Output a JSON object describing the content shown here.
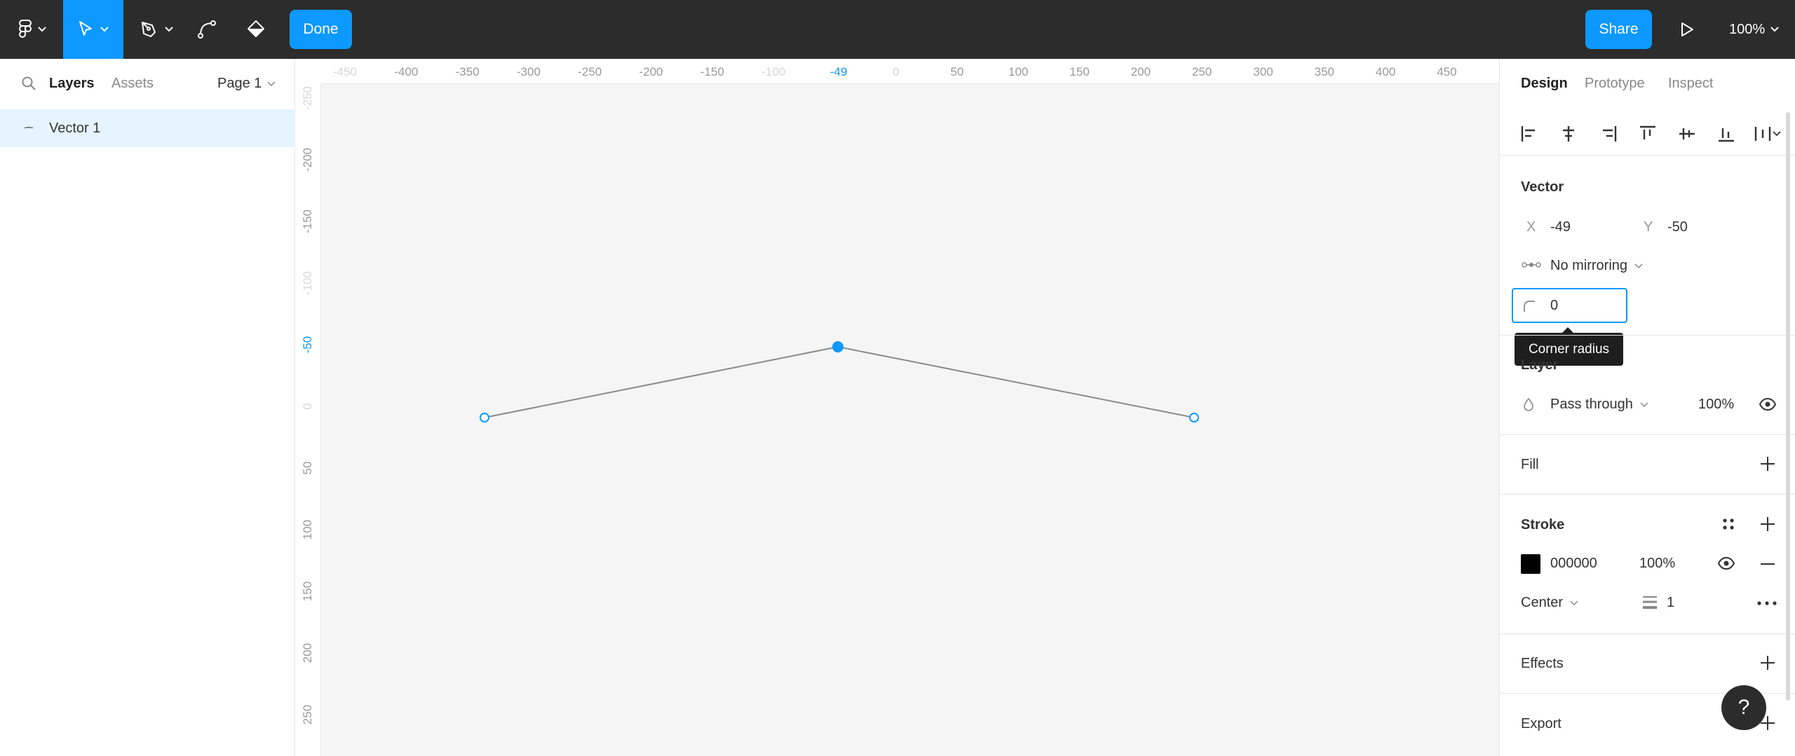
{
  "toolbar": {
    "done_label": "Done",
    "share_label": "Share",
    "zoom": "100%"
  },
  "left_panel": {
    "tabs": [
      "Layers",
      "Assets"
    ],
    "page_selector": "Page 1",
    "layers": [
      {
        "name": "Vector 1"
      }
    ]
  },
  "rulers": {
    "horizontal": [
      {
        "label": "-450",
        "muted": true
      },
      {
        "label": "-400"
      },
      {
        "label": "-350"
      },
      {
        "label": "-300"
      },
      {
        "label": "-250"
      },
      {
        "label": "-200"
      },
      {
        "label": "-150"
      },
      {
        "label": "-100",
        "muted": true
      },
      {
        "label": "-49",
        "accent": true
      },
      {
        "label": "0",
        "muted": true
      },
      {
        "label": "50"
      },
      {
        "label": "100"
      },
      {
        "label": "150"
      },
      {
        "label": "200"
      },
      {
        "label": "250"
      },
      {
        "label": "300"
      },
      {
        "label": "350"
      },
      {
        "label": "400"
      },
      {
        "label": "450"
      }
    ],
    "vertical": [
      {
        "label": "-250",
        "muted": true
      },
      {
        "label": "-200"
      },
      {
        "label": "-150"
      },
      {
        "label": "-100",
        "muted": true
      },
      {
        "label": "-50",
        "accent": true
      },
      {
        "label": "0",
        "muted": true
      },
      {
        "label": "50"
      },
      {
        "label": "100"
      },
      {
        "label": "150"
      },
      {
        "label": "200"
      },
      {
        "label": "250"
      }
    ]
  },
  "right_panel": {
    "tabs": [
      "Design",
      "Prototype",
      "Inspect"
    ],
    "vector": {
      "title": "Vector",
      "x_label": "X",
      "x_value": "-49",
      "y_label": "Y",
      "y_value": "-50",
      "mirroring": "No mirroring",
      "corner_radius": "0",
      "tooltip": "Corner radius"
    },
    "layer": {
      "title": "Layer",
      "blend_mode": "Pass through",
      "opacity": "100%"
    },
    "fill": {
      "title": "Fill"
    },
    "stroke": {
      "title": "Stroke",
      "color": "000000",
      "opacity": "100%",
      "position": "Center",
      "weight": "1"
    },
    "effects": {
      "title": "Effects"
    },
    "export": {
      "title": "Export"
    }
  },
  "help": {
    "label": "?"
  },
  "colors": {
    "accent": "#0d99ff",
    "toolbar": "#2c2c2c",
    "selection": "#e5f4ff"
  }
}
